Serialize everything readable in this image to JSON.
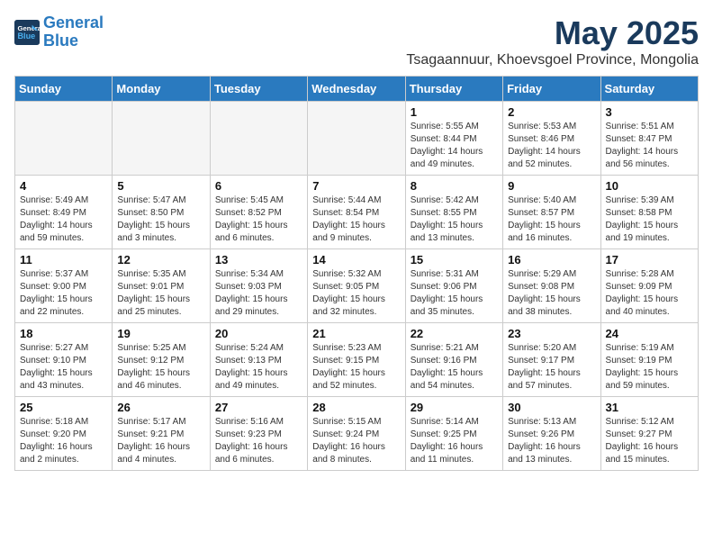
{
  "header": {
    "logo_line1": "General",
    "logo_line2": "Blue",
    "month_title": "May 2025",
    "subtitle": "Tsagaannuur, Khoevsgoel Province, Mongolia"
  },
  "weekdays": [
    "Sunday",
    "Monday",
    "Tuesday",
    "Wednesday",
    "Thursday",
    "Friday",
    "Saturday"
  ],
  "weeks": [
    [
      {
        "day": "",
        "empty": true
      },
      {
        "day": "",
        "empty": true
      },
      {
        "day": "",
        "empty": true
      },
      {
        "day": "",
        "empty": true
      },
      {
        "day": "1",
        "sunrise": "5:55 AM",
        "sunset": "8:44 PM",
        "daylight": "14 hours and 49 minutes."
      },
      {
        "day": "2",
        "sunrise": "5:53 AM",
        "sunset": "8:46 PM",
        "daylight": "14 hours and 52 minutes."
      },
      {
        "day": "3",
        "sunrise": "5:51 AM",
        "sunset": "8:47 PM",
        "daylight": "14 hours and 56 minutes."
      }
    ],
    [
      {
        "day": "4",
        "sunrise": "5:49 AM",
        "sunset": "8:49 PM",
        "daylight": "14 hours and 59 minutes."
      },
      {
        "day": "5",
        "sunrise": "5:47 AM",
        "sunset": "8:50 PM",
        "daylight": "15 hours and 3 minutes."
      },
      {
        "day": "6",
        "sunrise": "5:45 AM",
        "sunset": "8:52 PM",
        "daylight": "15 hours and 6 minutes."
      },
      {
        "day": "7",
        "sunrise": "5:44 AM",
        "sunset": "8:54 PM",
        "daylight": "15 hours and 9 minutes."
      },
      {
        "day": "8",
        "sunrise": "5:42 AM",
        "sunset": "8:55 PM",
        "daylight": "15 hours and 13 minutes."
      },
      {
        "day": "9",
        "sunrise": "5:40 AM",
        "sunset": "8:57 PM",
        "daylight": "15 hours and 16 minutes."
      },
      {
        "day": "10",
        "sunrise": "5:39 AM",
        "sunset": "8:58 PM",
        "daylight": "15 hours and 19 minutes."
      }
    ],
    [
      {
        "day": "11",
        "sunrise": "5:37 AM",
        "sunset": "9:00 PM",
        "daylight": "15 hours and 22 minutes."
      },
      {
        "day": "12",
        "sunrise": "5:35 AM",
        "sunset": "9:01 PM",
        "daylight": "15 hours and 25 minutes."
      },
      {
        "day": "13",
        "sunrise": "5:34 AM",
        "sunset": "9:03 PM",
        "daylight": "15 hours and 29 minutes."
      },
      {
        "day": "14",
        "sunrise": "5:32 AM",
        "sunset": "9:05 PM",
        "daylight": "15 hours and 32 minutes."
      },
      {
        "day": "15",
        "sunrise": "5:31 AM",
        "sunset": "9:06 PM",
        "daylight": "15 hours and 35 minutes."
      },
      {
        "day": "16",
        "sunrise": "5:29 AM",
        "sunset": "9:08 PM",
        "daylight": "15 hours and 38 minutes."
      },
      {
        "day": "17",
        "sunrise": "5:28 AM",
        "sunset": "9:09 PM",
        "daylight": "15 hours and 40 minutes."
      }
    ],
    [
      {
        "day": "18",
        "sunrise": "5:27 AM",
        "sunset": "9:10 PM",
        "daylight": "15 hours and 43 minutes."
      },
      {
        "day": "19",
        "sunrise": "5:25 AM",
        "sunset": "9:12 PM",
        "daylight": "15 hours and 46 minutes."
      },
      {
        "day": "20",
        "sunrise": "5:24 AM",
        "sunset": "9:13 PM",
        "daylight": "15 hours and 49 minutes."
      },
      {
        "day": "21",
        "sunrise": "5:23 AM",
        "sunset": "9:15 PM",
        "daylight": "15 hours and 52 minutes."
      },
      {
        "day": "22",
        "sunrise": "5:21 AM",
        "sunset": "9:16 PM",
        "daylight": "15 hours and 54 minutes."
      },
      {
        "day": "23",
        "sunrise": "5:20 AM",
        "sunset": "9:17 PM",
        "daylight": "15 hours and 57 minutes."
      },
      {
        "day": "24",
        "sunrise": "5:19 AM",
        "sunset": "9:19 PM",
        "daylight": "15 hours and 59 minutes."
      }
    ],
    [
      {
        "day": "25",
        "sunrise": "5:18 AM",
        "sunset": "9:20 PM",
        "daylight": "16 hours and 2 minutes."
      },
      {
        "day": "26",
        "sunrise": "5:17 AM",
        "sunset": "9:21 PM",
        "daylight": "16 hours and 4 minutes."
      },
      {
        "day": "27",
        "sunrise": "5:16 AM",
        "sunset": "9:23 PM",
        "daylight": "16 hours and 6 minutes."
      },
      {
        "day": "28",
        "sunrise": "5:15 AM",
        "sunset": "9:24 PM",
        "daylight": "16 hours and 8 minutes."
      },
      {
        "day": "29",
        "sunrise": "5:14 AM",
        "sunset": "9:25 PM",
        "daylight": "16 hours and 11 minutes."
      },
      {
        "day": "30",
        "sunrise": "5:13 AM",
        "sunset": "9:26 PM",
        "daylight": "16 hours and 13 minutes."
      },
      {
        "day": "31",
        "sunrise": "5:12 AM",
        "sunset": "9:27 PM",
        "daylight": "16 hours and 15 minutes."
      }
    ]
  ]
}
